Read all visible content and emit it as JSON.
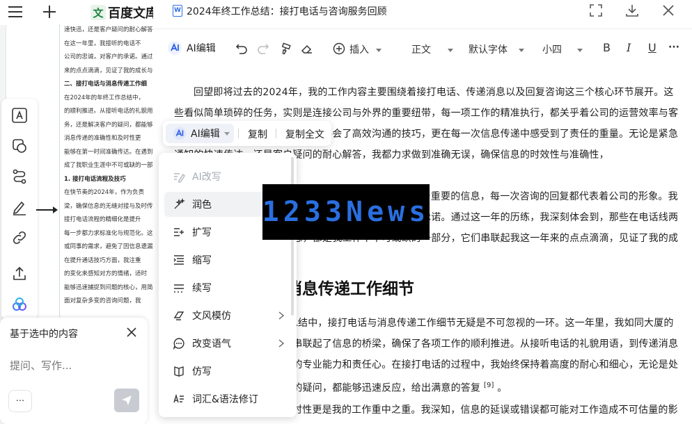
{
  "app": {
    "logo_mark": "文",
    "logo_text": "百度文库"
  },
  "background_doc": {
    "lines": [
      "速快迅，还是客户疑问的耐心解答",
      "在这一年里，我接听的电话不",
      "公司的忠诚，对客户的承诺。通过",
      "来的点点滴滴，见证了我的成长与",
      "二、接打电话与消息传递工作细",
      "在2024年的年终工作总结中，",
      "的顺利推进。从接听电话的礼貌用",
      "务，还是解决客户的疑问，都能够",
      "消息传递的准确性和及时性更",
      "能够在第一时间准确传达。在遇到",
      "成了我职业生涯中不可或缺的一部",
      "1. 接打电话流程及技巧",
      "在快节奏的2024年，作为负责",
      "梁，确保信息的无缝对接与及时传",
      "接打电话流程的精细化是提升",
      "每一步都力求标准化与规范化。这",
      "或同事的需求，避免了因信息遗漏",
      "在提升通话技巧方面，我注重",
      "的变化来感知对方的情绪，适时",
      "能够迅速捕捉到问题的核心，用简",
      "面对复杂多变的咨询问题，我"
    ]
  },
  "ask_panel": {
    "title": "基于选中的内容",
    "placeholder": "提问、写作...",
    "more_label": "···"
  },
  "editor": {
    "doc_icon_letter": "W",
    "title": "2024年终工作总结：接打电话与咨询服务回顾",
    "toolbar": {
      "ai_label": "AI编辑",
      "insert_label": "插入",
      "style_label": "正文",
      "font_label": "默认字体",
      "size_label": "小四",
      "bold": "B",
      "italic": "I",
      "underline": "U",
      "more": "···"
    },
    "para1": "回望即将过去的2024年，我的工作内容主要围绕着接打电话、传递消息以及回复咨询这三个核心环节展开。这些看似简单琐碎的任务，实则是连接公司与外界的重要纽带，每一项工作的精准执行，都关乎着公司的运营效率与客户的满意度。在这一年中，我不仅学会了高效沟通的技巧，更在每一次信息传递中感受到了责任的重量。无论是紧急通知的快速传达，还是客户疑问的耐心解答，我都力求做到准确无误，确保信息的时效性与准确性，",
    "para2": "在这一年里，我接听的电话不计其数，每一通都承载着重要的信息，每一次咨询的回复都代表着公司的形象。我始终牢记自己肩负的责任，一份对公司的忠诚，对客户的承诺。通过这一年的历练，我深刻体会到，那些在电话线两端，在屏幕上跳跃的咨询信息，都是我工作中不可或缺的一部分，它们串联起我这一年来的点点滴滴，见证了我的成长与蜕变。",
    "heading": "二、接打电话与消息传递工作细节",
    "para3": "在2024年的年终工作总结中，接打电话与消息传递工作细节无疑是不可忽视的一环。这一年里，我如同大厦的中枢神经，在公司内外之间串联起了信息的桥梁，确保了各项工作的顺利推进。从接听电话的礼貌用语，到传递消息的每一个细节，都考验着我的专业能力和责任心。在接打电话的过程中，我始终保持着高度的耐心和细心，无论是处理紧急任务，还是解决客户的疑问，都能够迅速反应，给出满意的答复",
    "para3_cite": "[9]",
    "para3_end": "。",
    "para4": "消息传递的准确性和及时性更是我的工作重中之重。我深知，信息的延误或错误都可能对工作造成不可估量的影"
  },
  "selection_toolbar": {
    "ai_label": "AI编辑",
    "copy_label": "复制",
    "copy_all_label": "复制全文"
  },
  "ai_menu": {
    "header": "AI改写",
    "items": [
      {
        "label": "润色",
        "icon": "polish-icon"
      },
      {
        "label": "扩写",
        "icon": "expand-icon"
      },
      {
        "label": "缩写",
        "icon": "shorten-icon"
      },
      {
        "label": "续写",
        "icon": "continue-icon"
      },
      {
        "label": "文风模仿",
        "icon": "style-icon"
      },
      {
        "label": "改变语气",
        "icon": "tone-icon"
      },
      {
        "label": "仿写",
        "icon": "imitate-icon"
      },
      {
        "label": "词汇&语法修订",
        "icon": "grammar-icon"
      }
    ]
  },
  "watermark": {
    "text": "1233News"
  }
}
